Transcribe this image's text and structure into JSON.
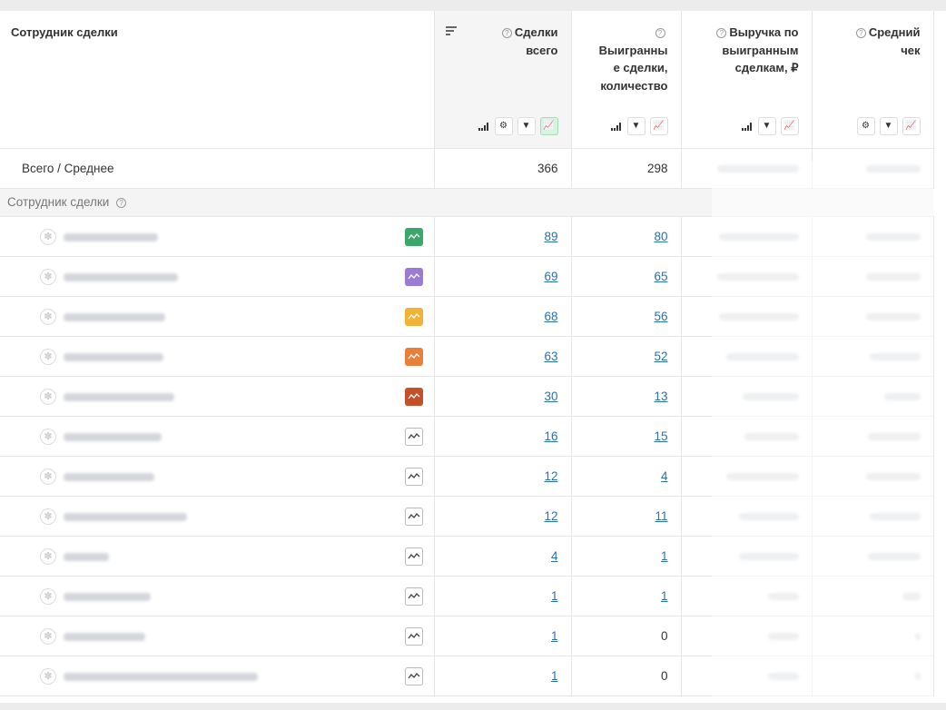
{
  "header": {
    "name_col": "Сотрудник сделки",
    "deals_col": "Сделки всего",
    "won_col": "Выигранны е сделки, количество",
    "revenue_col": "Выручка по выигранным сделкам, ₽",
    "avg_col": "Средний чек"
  },
  "totals": {
    "label": "Всего / Среднее",
    "deals": "366",
    "won": "298"
  },
  "group": {
    "label": "Сотрудник сделки"
  },
  "rows": [
    {
      "chip_color": "#3aa86b",
      "deals": "89",
      "won": "80",
      "won_link": true
    },
    {
      "chip_color": "#9b7bd4",
      "deals": "69",
      "won": "65",
      "won_link": true
    },
    {
      "chip_color": "#f2b233",
      "deals": "68",
      "won": "56",
      "won_link": true
    },
    {
      "chip_color": "#e8803a",
      "deals": "63",
      "won": "52",
      "won_link": true
    },
    {
      "chip_color": "#c4502a",
      "deals": "30",
      "won": "13",
      "won_link": true
    },
    {
      "chip_color": "",
      "deals": "16",
      "won": "15",
      "won_link": true
    },
    {
      "chip_color": "",
      "deals": "12",
      "won": "4",
      "won_link": true
    },
    {
      "chip_color": "",
      "deals": "12",
      "won": "11",
      "won_link": true
    },
    {
      "chip_color": "",
      "deals": "4",
      "won": "1",
      "won_link": true
    },
    {
      "chip_color": "",
      "deals": "1",
      "won": "1",
      "won_link": true
    },
    {
      "chip_color": "",
      "deals": "1",
      "won": "0",
      "won_link": false
    },
    {
      "chip_color": "",
      "deals": "1",
      "won": "0",
      "won_link": false
    }
  ]
}
